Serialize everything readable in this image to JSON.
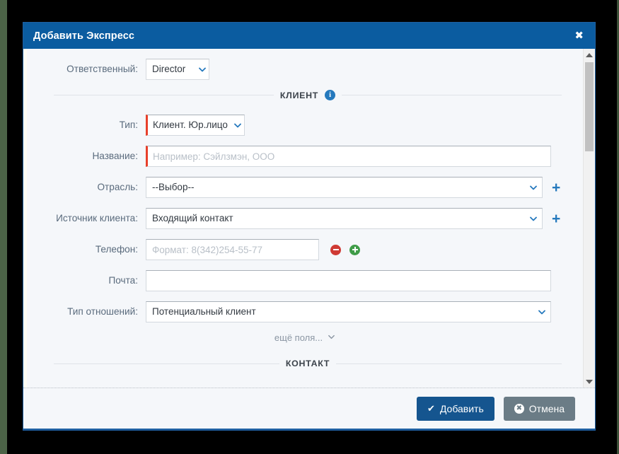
{
  "modal": {
    "title": "Добавить Экспресс",
    "close_label": "✖"
  },
  "form": {
    "responsible": {
      "label": "Ответственный:",
      "value": "Director"
    },
    "sections": {
      "client": {
        "title": "КЛИЕНТ",
        "info_icon": "info-icon",
        "info_glyph": "i"
      },
      "contact": {
        "title": "КОНТАКТ"
      }
    },
    "type": {
      "label": "Тип:",
      "value": "Клиент. Юр.лицо"
    },
    "name": {
      "label": "Название:",
      "value": "",
      "placeholder": "Например: Сэйлзмэн, ООО"
    },
    "industry": {
      "label": "Отрасль:",
      "value": "--Выбор--",
      "add_label": "+"
    },
    "client_source": {
      "label": "Источник клиента:",
      "value": "Входящий контакт",
      "add_label": "+"
    },
    "phone": {
      "label": "Телефон:",
      "value": "",
      "placeholder": "Формат: 8(342)254-55-77",
      "remove_icon": "circle-minus-icon",
      "add_icon": "circle-plus-icon"
    },
    "email": {
      "label": "Почта:",
      "value": ""
    },
    "relation_type": {
      "label": "Тип отношений:",
      "value": "Потенциальный клиент"
    },
    "more_fields": {
      "label": "ещё поля..."
    }
  },
  "footer": {
    "submit_label": "Добавить",
    "submit_icon": "check-icon",
    "cancel_label": "Отмена",
    "cancel_icon": "circle-x-icon"
  },
  "colors": {
    "header_blue": "#0b5ca0",
    "primary_button": "#15558f",
    "secondary_button": "#6b7c86",
    "required_marker": "#e8402a",
    "accent_link": "#2579bd",
    "remove_red": "#cf3a34",
    "add_green": "#3f9c48"
  }
}
